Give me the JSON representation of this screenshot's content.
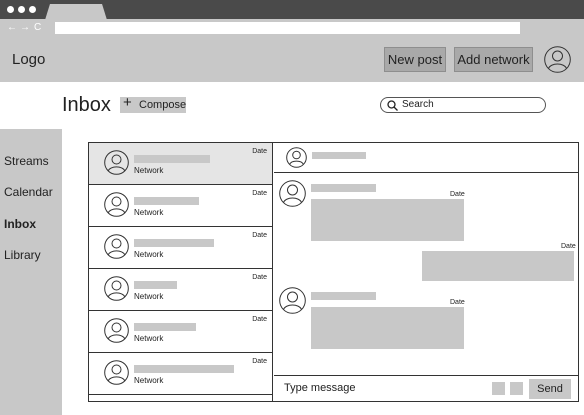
{
  "browser": {
    "nav_back": "←",
    "nav_forward": "→",
    "nav_reload": "C"
  },
  "header": {
    "logo": "Logo",
    "new_post_label": "New post",
    "add_network_label": "Add network"
  },
  "page": {
    "title": "Inbox",
    "compose_label": "Compose",
    "search_placeholder": "Search"
  },
  "sidebar": {
    "items": [
      {
        "label": "Streams",
        "active": false
      },
      {
        "label": "Calendar",
        "active": false
      },
      {
        "label": "Inbox",
        "active": true
      },
      {
        "label": "Library",
        "active": false
      }
    ]
  },
  "conversations": [
    {
      "network": "Network",
      "date": "Date",
      "selected": true
    },
    {
      "network": "Network",
      "date": "Date",
      "selected": false
    },
    {
      "network": "Network",
      "date": "Date",
      "selected": false
    },
    {
      "network": "Network",
      "date": "Date",
      "selected": false
    },
    {
      "network": "Network",
      "date": "Date",
      "selected": false
    },
    {
      "network": "Network",
      "date": "Date",
      "selected": false
    }
  ],
  "thread": {
    "messages": [
      {
        "direction": "incoming",
        "date": "Date"
      },
      {
        "direction": "outgoing",
        "date": "Date"
      },
      {
        "direction": "incoming",
        "date": "Date"
      }
    ],
    "input_placeholder": "Type message",
    "send_label": "Send"
  },
  "colors": {
    "chrome_dark": "#4a4a4a",
    "panel_gray": "#c8c8c8",
    "button_gray": "#a9a9a9",
    "selected_row": "#e5e5e5"
  }
}
